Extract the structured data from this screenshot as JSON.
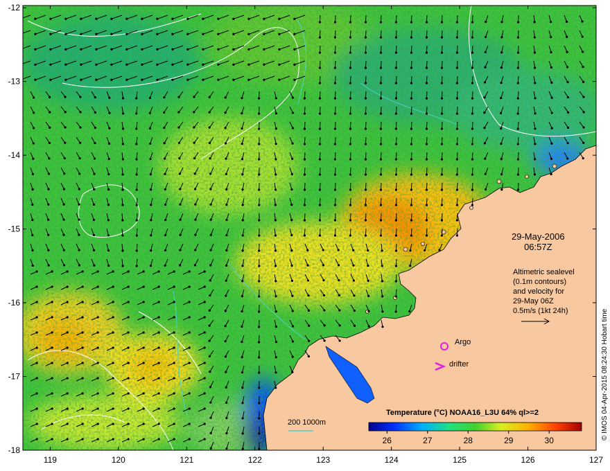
{
  "x_axis": {
    "ticks": [
      {
        "value": 119,
        "label": "119"
      },
      {
        "value": 120,
        "label": "120"
      },
      {
        "value": 121,
        "label": "121"
      },
      {
        "value": 122,
        "label": "122"
      },
      {
        "value": 123,
        "label": "123"
      },
      {
        "value": 124,
        "label": "124"
      },
      {
        "value": 125,
        "label": "125"
      },
      {
        "value": 126,
        "label": "126"
      },
      {
        "value": 127,
        "label": "127"
      }
    ],
    "range": [
      118.6,
      127
    ]
  },
  "y_axis": {
    "ticks": [
      {
        "value": -12,
        "label": "-12"
      },
      {
        "value": -13,
        "label": "-13"
      },
      {
        "value": -14,
        "label": "-14"
      },
      {
        "value": -15,
        "label": "-15"
      },
      {
        "value": -16,
        "label": "-16"
      },
      {
        "value": -17,
        "label": "-17"
      },
      {
        "value": -18,
        "label": "-18"
      }
    ],
    "range": [
      -18,
      -11.97
    ]
  },
  "date": {
    "line1": "29-May-2006",
    "line2": "06:57Z"
  },
  "altimetry": {
    "lines": [
      "Altimetric sealevel",
      "(0.1m contours)",
      "and velocity for",
      "29-May 06Z",
      "0.5m/s (1kt 24h)"
    ]
  },
  "legend": {
    "title": "Temperature (°C) NOAA16_L3U 64% ql>=2",
    "ticks": [
      {
        "value": 26,
        "label": "26"
      },
      {
        "value": 27,
        "label": "27"
      },
      {
        "value": 28,
        "label": "28"
      },
      {
        "value": 29,
        "label": "29"
      },
      {
        "value": 30,
        "label": "30"
      }
    ],
    "range": [
      25.55,
      30.8
    ]
  },
  "scale": {
    "label": "200  1000m"
  },
  "markers": {
    "argo": "Argo",
    "drifter": "drifter"
  },
  "credit": "© IMOS 04-Apr-2015 08:24:30 Hobart time",
  "colors": {
    "land": "#f8c8a0",
    "sst_cold": "#00008a",
    "sst_warm": "#a00000",
    "contour": "#ffffff",
    "bathy": "#50d0c8",
    "marker": "#e020e0",
    "vector": "#000000"
  },
  "icons": [
    "argo-circle-icon",
    "drifter-chevron-icon",
    "velocity-arrow-icon"
  ]
}
